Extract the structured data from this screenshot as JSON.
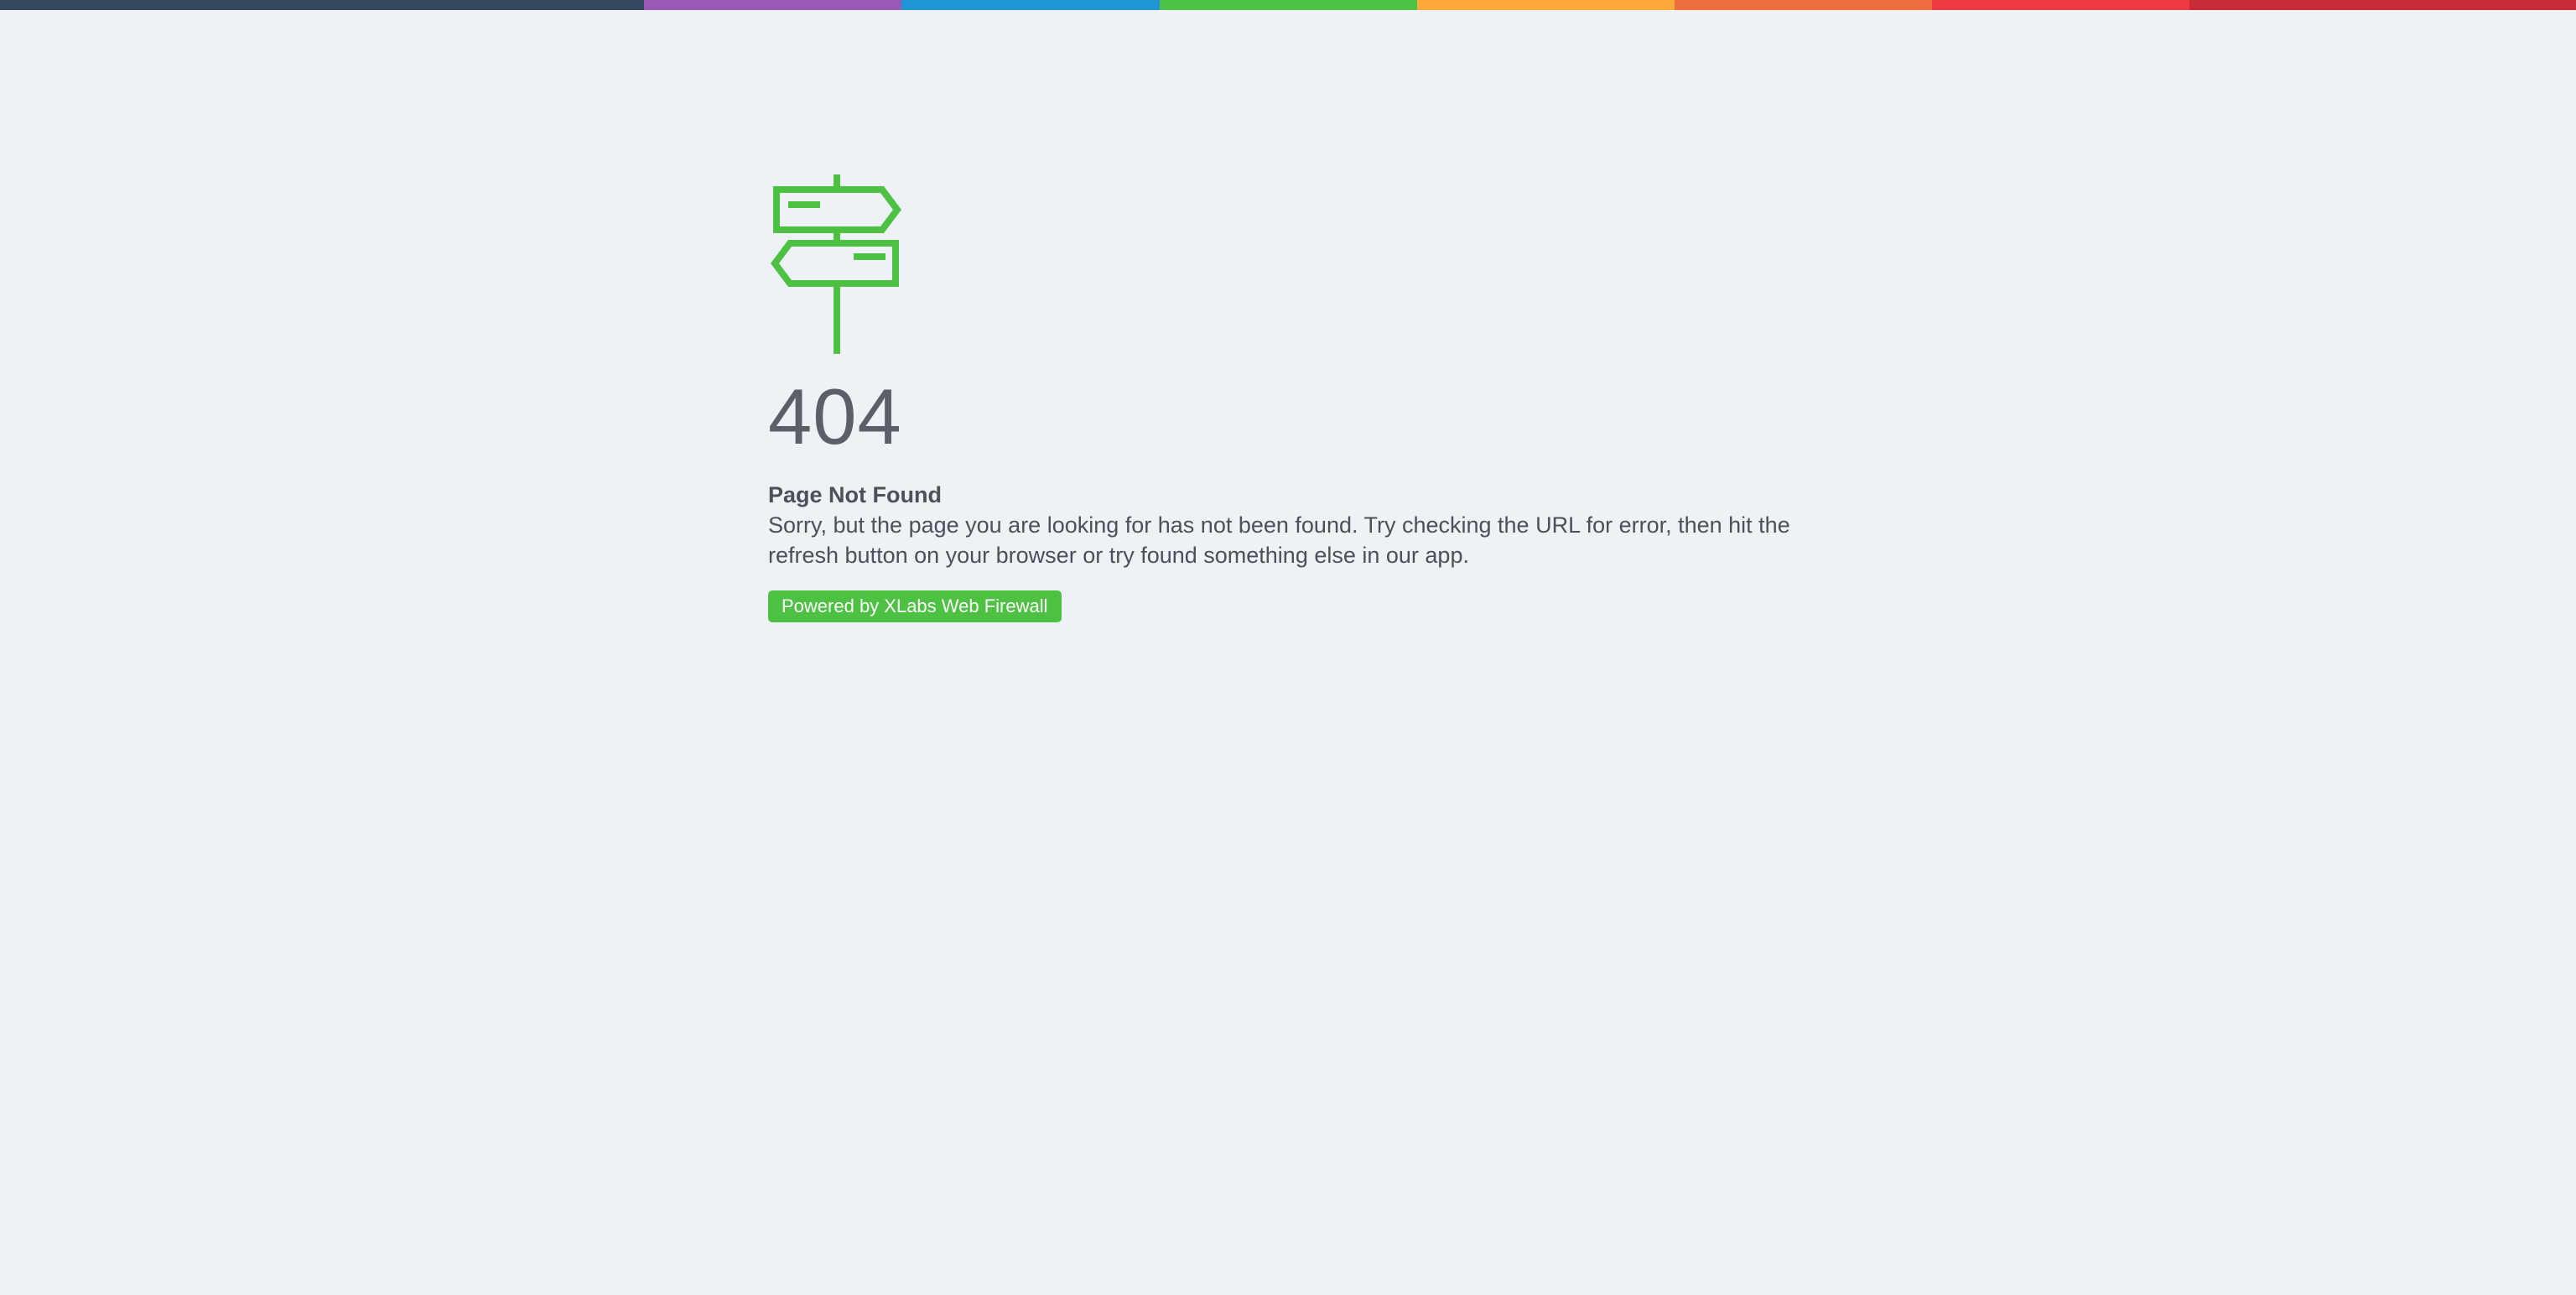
{
  "topbar": {
    "colors": [
      "#34495e",
      "#9b59b6",
      "#1f95d6",
      "#4cc247",
      "#ffa83c",
      "#ee6d3c",
      "#ee3b43",
      "#c92c39"
    ]
  },
  "icon": {
    "name": "signpost-icon",
    "color": "#4dc142"
  },
  "error": {
    "code": "404",
    "title": "Page Not Found",
    "message": "Sorry, but the page you are looking for has not been found. Try checking the URL for error, then hit the refresh button on your browser or try found something else in our app."
  },
  "footer": {
    "badge_label": "Powered by XLabs Web Firewall"
  }
}
